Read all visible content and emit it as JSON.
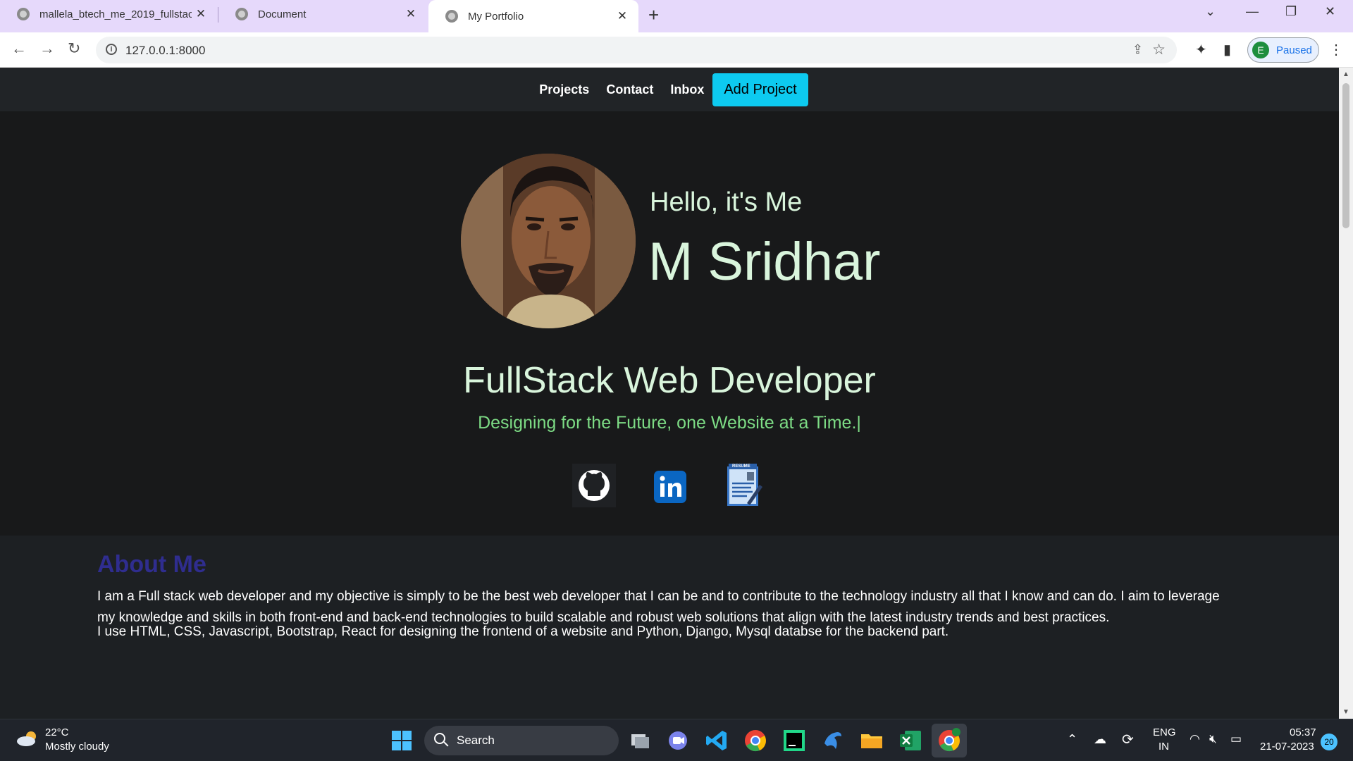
{
  "browser": {
    "tabs": [
      {
        "title": "mallela_btech_me_2019_fullstack",
        "active": false
      },
      {
        "title": "Document",
        "active": false
      },
      {
        "title": "My Portfolio",
        "active": true
      }
    ],
    "new_tab": "+",
    "url": "127.0.0.1:8000",
    "profile_initial": "E",
    "profile_status": "Paused"
  },
  "site": {
    "nav": {
      "projects": "Projects",
      "contact": "Contact",
      "inbox": "Inbox",
      "add_project": "Add Project"
    },
    "hero": {
      "greeting": "Hello, it's Me",
      "name": "M Sridhar",
      "role": "FullStack Web Developer",
      "tagline": "Designing for the Future, one Website at a Time.|"
    },
    "social": [
      "github-icon",
      "linkedin-icon",
      "resume-icon"
    ],
    "resume_badge": "RESUME",
    "about": {
      "heading": "About Me",
      "p1": "I am a Full stack web developer and my objective is simply to be the best web developer that I can be and to contribute to the technology industry all that I know and can do. I aim to leverage my knowledge and skills in both front-end and back-end technologies to build scalable and robust web solutions that align with the latest industry trends and best practices.",
      "p2": "I use HTML, CSS, Javascript, Bootstrap, React for designing the frontend of a website and Python, Django, Mysql databse for the backend part."
    },
    "colors": {
      "accent_button": "#0dcaf0",
      "heading_green": "#d9f5dc",
      "tagline_green": "#7ddc85",
      "about_heading": "#2f2d8f"
    }
  },
  "taskbar": {
    "weather_temp": "22°C",
    "weather_desc": "Mostly cloudy",
    "search_label": "Search",
    "lang_top": "ENG",
    "lang_bottom": "IN",
    "time": "05:37",
    "date": "21-07-2023",
    "notification_count": "20"
  }
}
